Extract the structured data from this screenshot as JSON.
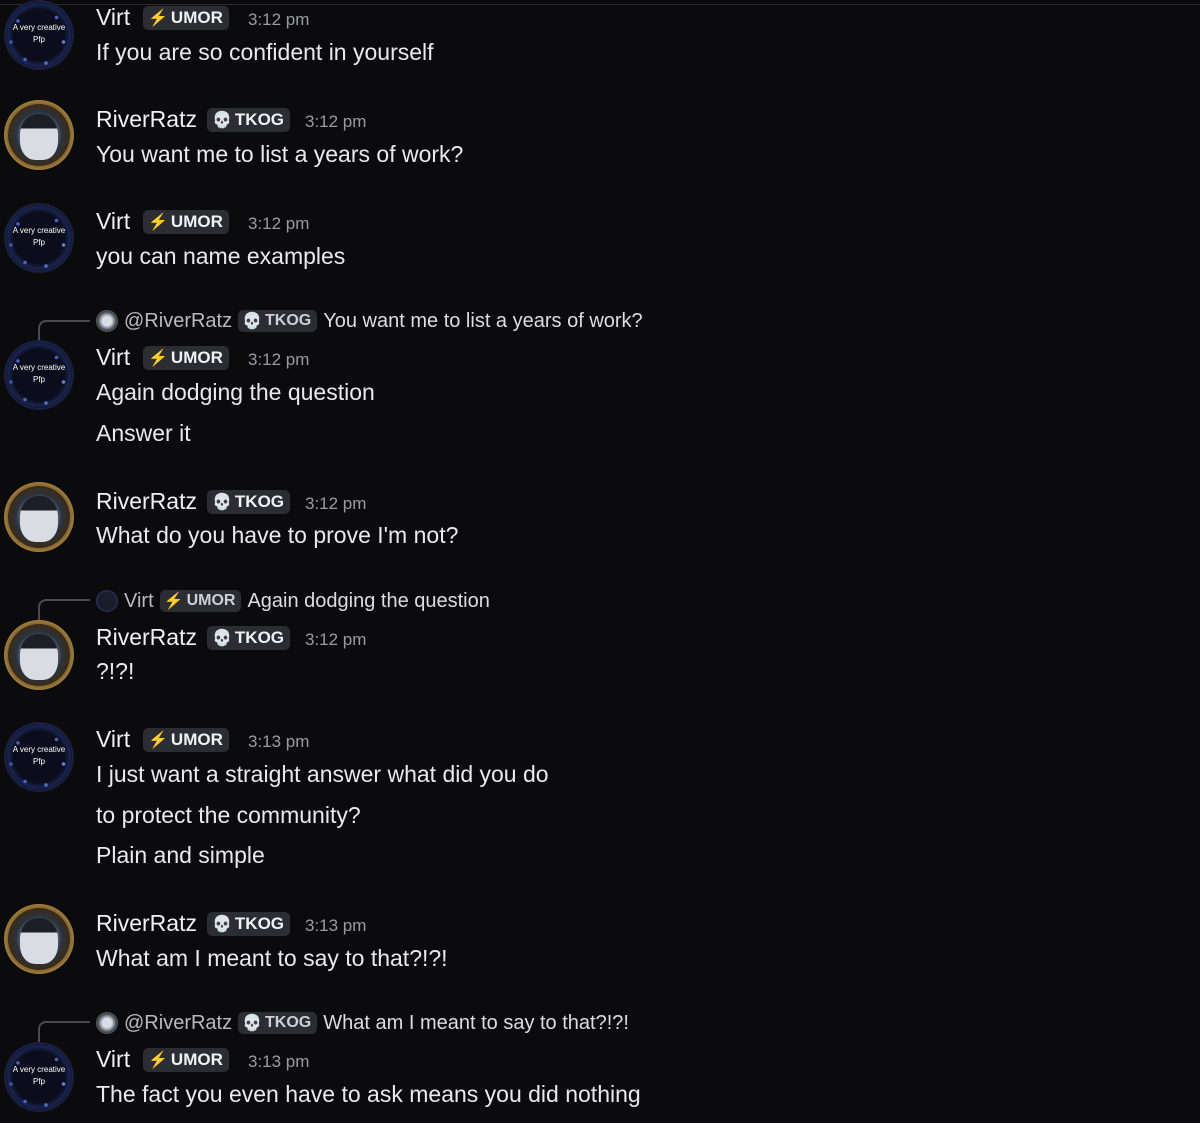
{
  "users": {
    "virt": {
      "name": "Virt",
      "tag": "UMOR",
      "tag_icon": "lightning-bolt-icon",
      "avatar_caption_1": "A very creative",
      "avatar_caption_2": "Pfp"
    },
    "river": {
      "name": "RiverRatz",
      "tag": "TKOG",
      "tag_icon": "skull-icon"
    }
  },
  "messages": [
    {
      "author": "Virt",
      "tag": "UMOR",
      "time": "3:12 pm",
      "lines": [
        "If you are so confident in yourself"
      ]
    },
    {
      "author": "RiverRatz",
      "tag": "TKOG",
      "time": "3:12 pm",
      "lines": [
        "You want me to list a years of work?"
      ]
    },
    {
      "author": "Virt",
      "tag": "UMOR",
      "time": "3:12 pm",
      "lines": [
        "you can name examples"
      ]
    },
    {
      "reply": {
        "name": "@RiverRatz",
        "tag": "TKOG",
        "text": "You want me to list a years of work?"
      },
      "author": "Virt",
      "tag": "UMOR",
      "time": "3:12 pm",
      "lines": [
        "Again dodging the question",
        "Answer it"
      ]
    },
    {
      "author": "RiverRatz",
      "tag": "TKOG",
      "time": "3:12 pm",
      "lines": [
        "What do you have to prove I'm not?"
      ]
    },
    {
      "reply": {
        "name": "Virt",
        "tag": "UMOR",
        "text": "Again dodging the question"
      },
      "author": "RiverRatz",
      "tag": "TKOG",
      "time": "3:12 pm",
      "lines": [
        "?!?!"
      ]
    },
    {
      "author": "Virt",
      "tag": "UMOR",
      "time": "3:13 pm",
      "lines": [
        "I just want a straight answer what did you do",
        "to protect the community?",
        "Plain and simple"
      ]
    },
    {
      "author": "RiverRatz",
      "tag": "TKOG",
      "time": "3:13 pm",
      "lines": [
        "What am I meant to say to that?!?!"
      ]
    },
    {
      "reply": {
        "name": "@RiverRatz",
        "tag": "TKOG",
        "text": "What am I meant to say to that?!?!"
      },
      "author": "Virt",
      "tag": "UMOR",
      "time": "3:13 pm",
      "lines": [
        "The fact you even have to ask means you did nothing"
      ]
    }
  ],
  "colors": {
    "background": "#0b0b0e",
    "tag_bg": "#2b2d33",
    "bolt": "#e34a6f",
    "skull": "#9fd8c7",
    "time": "#9a9aa3"
  }
}
